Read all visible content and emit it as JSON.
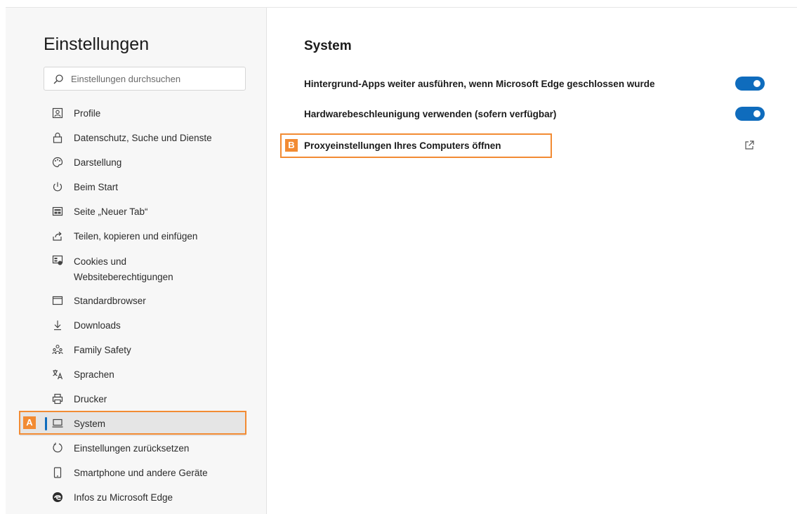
{
  "sidebar": {
    "title": "Einstellungen",
    "search_placeholder": "Einstellungen durchsuchen",
    "items": [
      {
        "label": "Profile",
        "icon": "profile-icon"
      },
      {
        "label": "Datenschutz, Suche und Dienste",
        "icon": "lock-icon"
      },
      {
        "label": "Darstellung",
        "icon": "palette-icon"
      },
      {
        "label": "Beim Start",
        "icon": "power-icon"
      },
      {
        "label": "Seite „Neuer Tab“",
        "icon": "new-tab-icon"
      },
      {
        "label": "Teilen, kopieren und einfügen",
        "icon": "share-icon"
      },
      {
        "label": "Cookies und",
        "label2": "Websiteberechtigungen",
        "icon": "cookies-icon"
      },
      {
        "label": "Standardbrowser",
        "icon": "browser-icon"
      },
      {
        "label": "Downloads",
        "icon": "download-icon"
      },
      {
        "label": "Family Safety",
        "icon": "family-icon"
      },
      {
        "label": "Sprachen",
        "icon": "language-icon"
      },
      {
        "label": "Drucker",
        "icon": "printer-icon"
      },
      {
        "label": "System",
        "icon": "system-icon",
        "active": true
      },
      {
        "label": "Einstellungen zurücksetzen",
        "icon": "reset-icon"
      },
      {
        "label": "Smartphone und andere Geräte",
        "icon": "phone-icon"
      },
      {
        "label": "Infos zu Microsoft Edge",
        "icon": "edge-icon"
      }
    ]
  },
  "main": {
    "title": "System",
    "settings": [
      {
        "label": "Hintergrund-Apps weiter ausführen, wenn Microsoft Edge geschlossen wurde",
        "type": "toggle",
        "on": true
      },
      {
        "label": "Hardwarebeschleunigung verwenden (sofern verfügbar)",
        "type": "toggle",
        "on": true
      },
      {
        "label": "Proxyeinstellungen Ihres Computers öffnen",
        "type": "external-link"
      }
    ]
  },
  "callouts": {
    "a": "A",
    "b": "B"
  },
  "colors": {
    "accent": "#0f6cbd",
    "callout": "#f28b33",
    "active_bg": "#e5e5e5"
  }
}
